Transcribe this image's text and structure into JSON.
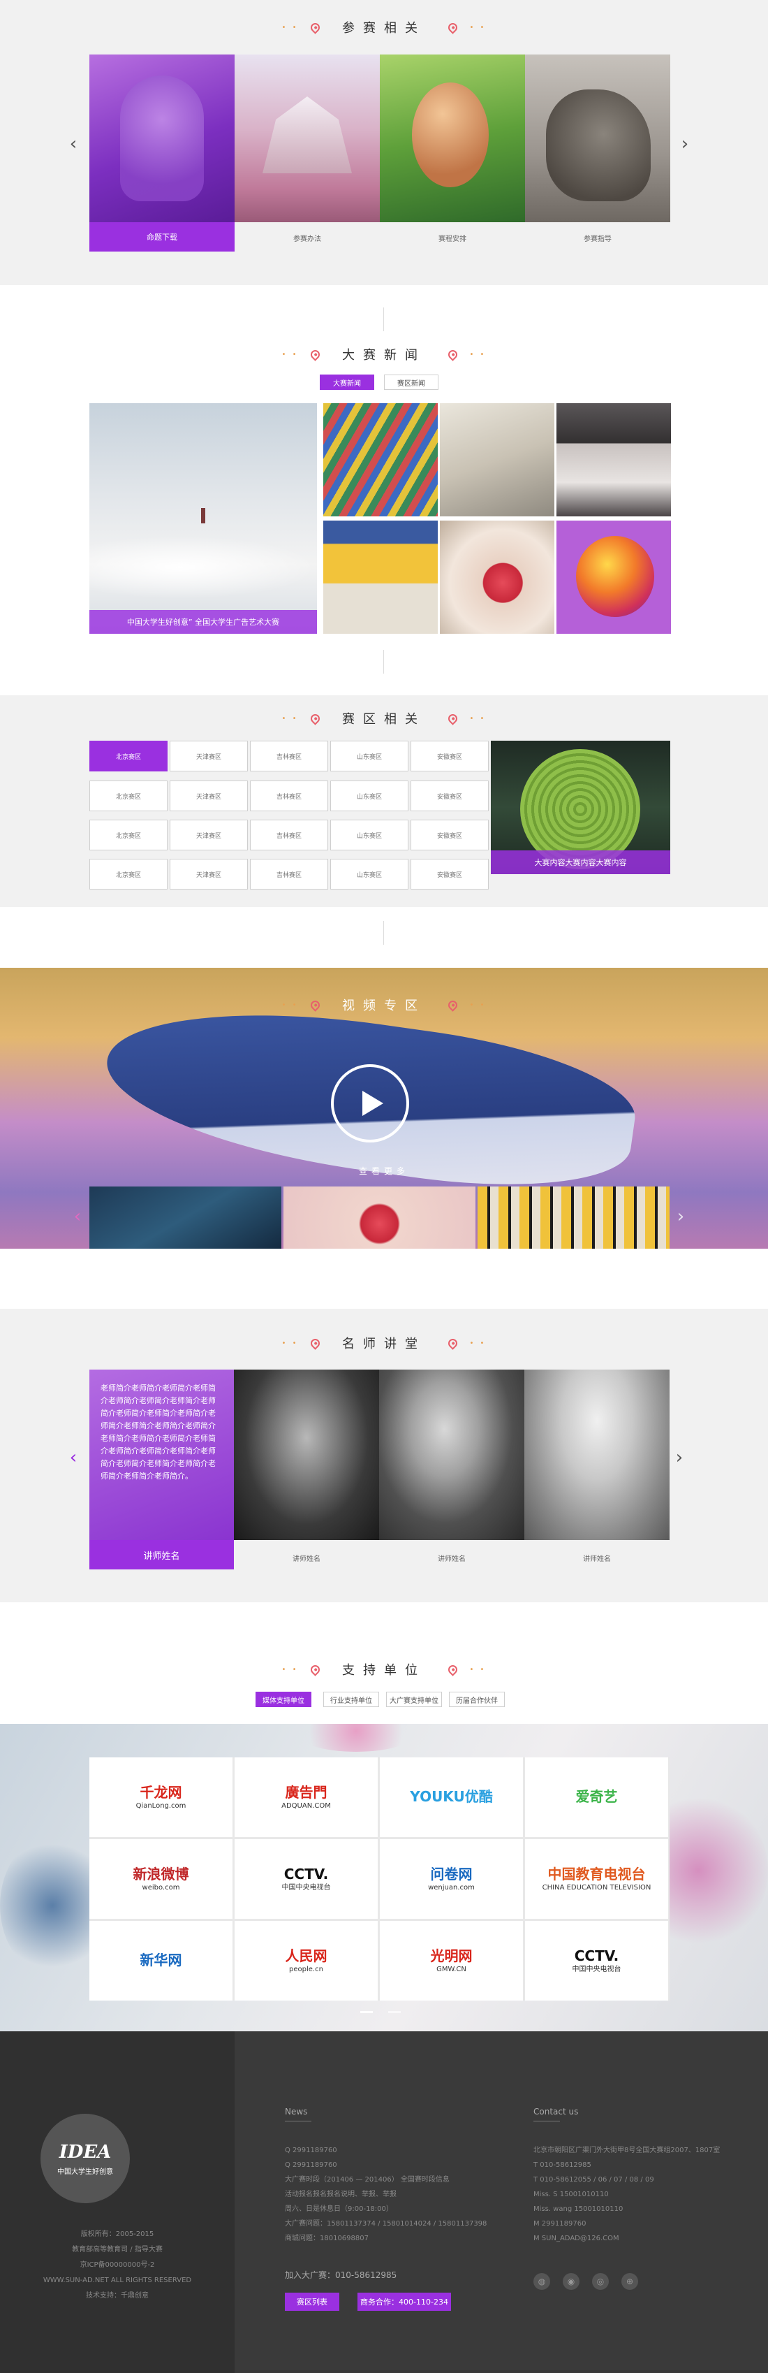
{
  "related": {
    "title": "参赛相关",
    "cards": [
      {
        "label": "命题下载"
      },
      {
        "label": "参赛办法"
      },
      {
        "label": "赛程安排"
      },
      {
        "label": "参赛指导"
      }
    ]
  },
  "news": {
    "title": "大赛新闻",
    "tabs": [
      "大赛新闻",
      "赛区新闻"
    ],
    "featured_caption": "中国大学生好创意” 全国大学生广告艺术大赛"
  },
  "division": {
    "title": "赛区相关",
    "buttons": [
      "北京赛区",
      "天津赛区",
      "吉林赛区",
      "山东赛区",
      "安徽赛区",
      "北京赛区",
      "天津赛区",
      "吉林赛区",
      "山东赛区",
      "安徽赛区",
      "北京赛区",
      "天津赛区",
      "吉林赛区",
      "山东赛区",
      "安徽赛区",
      "北京赛区",
      "天津赛区",
      "吉林赛区",
      "山东赛区",
      "安徽赛区"
    ],
    "feature_caption": "大赛内容大赛内容大赛内容"
  },
  "video": {
    "title": "视频专区",
    "more": "查看更多"
  },
  "lecture": {
    "title": "名师讲堂",
    "intro": "老师简介老师简介老师简介老师简介老师简介老师简介老师简介老师简介老师简介老师简介老师简介老师简介老师简介老师简介老师简介老师简介老师简介老师简介老师简介老师简介老师简介老师简介老师简介老师简介老师简介老师简介老师简介老师简介老师简介。",
    "featured_name": "讲师姓名",
    "names": [
      "讲师姓名",
      "讲师姓名",
      "讲师姓名"
    ]
  },
  "support": {
    "title": "支持单位",
    "tabs": [
      "媒体支持单位",
      "行业支持单位",
      "大广赛支持单位",
      "历届合作伙伴"
    ],
    "logos": [
      {
        "icon": "qianlong-logo",
        "main": "千龙网",
        "sub": "QianLong.com"
      },
      {
        "icon": "adquan-logo",
        "main": "廣告門",
        "sub": "ADQUAN.COM"
      },
      {
        "icon": "youku-logo",
        "main": "YOUKU优酷",
        "sub": ""
      },
      {
        "icon": "iqiyi-logo",
        "main": "爱奇艺",
        "sub": ""
      },
      {
        "icon": "weibo-logo",
        "main": "新浪微博",
        "sub": "weibo.com"
      },
      {
        "icon": "cctv-logo",
        "main": "CCTV.",
        "sub": "中国中央电视台"
      },
      {
        "icon": "wenjuan-logo",
        "main": "问卷网",
        "sub": "wenjuan.com"
      },
      {
        "icon": "cetv-logo",
        "main": "中国教育电视台",
        "sub": "CHINA EDUCATION TELEVISION"
      },
      {
        "icon": "xinhua-logo",
        "main": "新华网",
        "sub": ""
      },
      {
        "icon": "peoplecn-logo",
        "main": "人民网",
        "sub": "people.cn"
      },
      {
        "icon": "mw-logo",
        "main": "光明网",
        "sub": "GMW.CN"
      },
      {
        "icon": "cctv-logo",
        "main": "CCTV.",
        "sub": "中国中央电视台"
      }
    ]
  },
  "footer": {
    "logo_text": "IDEA",
    "logo_sub": "中国大学生好创意",
    "left_lines": [
      "版权所有：2005-2015",
      "教育部高等教育司 / 指导大赛",
      "京ICP备00000000号-2",
      "WWW.SUN-AD.NET ALL RIGHTS RESERVED",
      "技术支持：千鼎创意"
    ],
    "news_title": "News",
    "news_lines": [
      "Q  2991189760",
      "Q  2991189760",
      "大广赛时段（201406 — 201406）  全国赛时段信息",
      "活动报名报名报名说明、举报、举报",
      "周六、日是休息日（9:00-18:00）",
      "大广赛问题：15801137374 / 15801014024 / 15801137398",
      "商城问题：18010698807"
    ],
    "join_text": "加入大广赛：010-58612985",
    "btn1": "赛区列表",
    "btn2": "商务合作：400-110-234",
    "contact_title": "Contact us",
    "contact_lines": [
      "北京市朝阳区广渠门外大街甲8号全国大赛组2007、1807室",
      "T  010-58612985",
      "T  010-58612055 / 06 / 07 / 08 / 09",
      "Miss. S         15001010110",
      "Miss. wang   15001010110",
      "M  2991189760",
      "M  SUN_ADAD@126.COM"
    ]
  }
}
